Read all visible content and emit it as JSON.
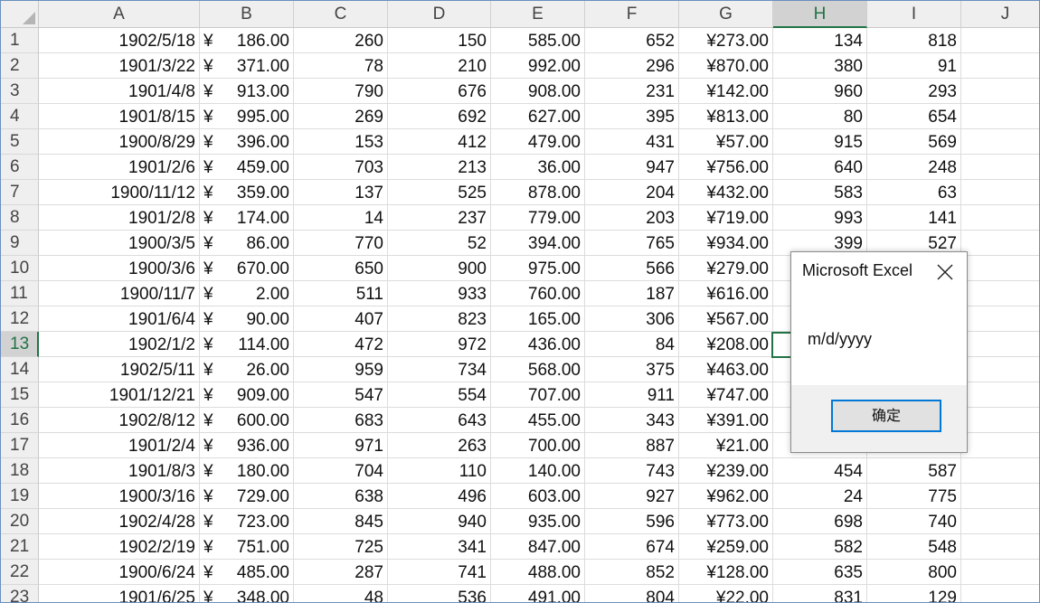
{
  "columns": [
    "A",
    "B",
    "C",
    "D",
    "E",
    "F",
    "G",
    "H",
    "I",
    "J"
  ],
  "selected_column": "H",
  "selected_row": "13",
  "rows": [
    {
      "n": "1",
      "A": "1902/5/18",
      "B": "186.00",
      "C": "260",
      "D": "150",
      "E": "585.00",
      "F": "652",
      "G": "¥273.00",
      "H": "134",
      "I": "818"
    },
    {
      "n": "2",
      "A": "1901/3/22",
      "B": "371.00",
      "C": "78",
      "D": "210",
      "E": "992.00",
      "F": "296",
      "G": "¥870.00",
      "H": "380",
      "I": "91"
    },
    {
      "n": "3",
      "A": "1901/4/8",
      "B": "913.00",
      "C": "790",
      "D": "676",
      "E": "908.00",
      "F": "231",
      "G": "¥142.00",
      "H": "960",
      "I": "293"
    },
    {
      "n": "4",
      "A": "1901/8/15",
      "B": "995.00",
      "C": "269",
      "D": "692",
      "E": "627.00",
      "F": "395",
      "G": "¥813.00",
      "H": "80",
      "I": "654"
    },
    {
      "n": "5",
      "A": "1900/8/29",
      "B": "396.00",
      "C": "153",
      "D": "412",
      "E": "479.00",
      "F": "431",
      "G": "¥57.00",
      "H": "915",
      "I": "569"
    },
    {
      "n": "6",
      "A": "1901/2/6",
      "B": "459.00",
      "C": "703",
      "D": "213",
      "E": "36.00",
      "F": "947",
      "G": "¥756.00",
      "H": "640",
      "I": "248"
    },
    {
      "n": "7",
      "A": "1900/11/12",
      "B": "359.00",
      "C": "137",
      "D": "525",
      "E": "878.00",
      "F": "204",
      "G": "¥432.00",
      "H": "583",
      "I": "63"
    },
    {
      "n": "8",
      "A": "1901/2/8",
      "B": "174.00",
      "C": "14",
      "D": "237",
      "E": "779.00",
      "F": "203",
      "G": "¥719.00",
      "H": "993",
      "I": "141"
    },
    {
      "n": "9",
      "A": "1900/3/5",
      "B": "86.00",
      "C": "770",
      "D": "52",
      "E": "394.00",
      "F": "765",
      "G": "¥934.00",
      "H": "399",
      "I": "527"
    },
    {
      "n": "10",
      "A": "1900/3/6",
      "B": "670.00",
      "C": "650",
      "D": "900",
      "E": "975.00",
      "F": "566",
      "G": "¥279.00",
      "H": "",
      "I": ""
    },
    {
      "n": "11",
      "A": "1900/11/7",
      "B": "2.00",
      "C": "511",
      "D": "933",
      "E": "760.00",
      "F": "187",
      "G": "¥616.00",
      "H": "",
      "I": ""
    },
    {
      "n": "12",
      "A": "1901/6/4",
      "B": "90.00",
      "C": "407",
      "D": "823",
      "E": "165.00",
      "F": "306",
      "G": "¥567.00",
      "H": "",
      "I": ""
    },
    {
      "n": "13",
      "A": "1902/1/2",
      "B": "114.00",
      "C": "472",
      "D": "972",
      "E": "436.00",
      "F": "84",
      "G": "¥208.00",
      "H": "",
      "I": ""
    },
    {
      "n": "14",
      "A": "1902/5/11",
      "B": "26.00",
      "C": "959",
      "D": "734",
      "E": "568.00",
      "F": "375",
      "G": "¥463.00",
      "H": "",
      "I": ""
    },
    {
      "n": "15",
      "A": "1901/12/21",
      "B": "909.00",
      "C": "547",
      "D": "554",
      "E": "707.00",
      "F": "911",
      "G": "¥747.00",
      "H": "",
      "I": ""
    },
    {
      "n": "16",
      "A": "1902/8/12",
      "B": "600.00",
      "C": "683",
      "D": "643",
      "E": "455.00",
      "F": "343",
      "G": "¥391.00",
      "H": "",
      "I": ""
    },
    {
      "n": "17",
      "A": "1901/2/4",
      "B": "936.00",
      "C": "971",
      "D": "263",
      "E": "700.00",
      "F": "887",
      "G": "¥21.00",
      "H": "",
      "I": ""
    },
    {
      "n": "18",
      "A": "1901/8/3",
      "B": "180.00",
      "C": "704",
      "D": "110",
      "E": "140.00",
      "F": "743",
      "G": "¥239.00",
      "H": "454",
      "I": "587"
    },
    {
      "n": "19",
      "A": "1900/3/16",
      "B": "729.00",
      "C": "638",
      "D": "496",
      "E": "603.00",
      "F": "927",
      "G": "¥962.00",
      "H": "24",
      "I": "775"
    },
    {
      "n": "20",
      "A": "1902/4/28",
      "B": "723.00",
      "C": "845",
      "D": "940",
      "E": "935.00",
      "F": "596",
      "G": "¥773.00",
      "H": "698",
      "I": "740"
    },
    {
      "n": "21",
      "A": "1902/2/19",
      "B": "751.00",
      "C": "725",
      "D": "341",
      "E": "847.00",
      "F": "674",
      "G": "¥259.00",
      "H": "582",
      "I": "548"
    },
    {
      "n": "22",
      "A": "1900/6/24",
      "B": "485.00",
      "C": "287",
      "D": "741",
      "E": "488.00",
      "F": "852",
      "G": "¥128.00",
      "H": "635",
      "I": "800"
    },
    {
      "n": "23",
      "A": "1901/6/25",
      "B": "348.00",
      "C": "48",
      "D": "536",
      "E": "491.00",
      "F": "804",
      "G": "¥22.00",
      "H": "831",
      "I": "129"
    }
  ],
  "currency_symbol": "¥",
  "dialog": {
    "title": "Microsoft Excel",
    "message": "m/d/yyyy",
    "ok_label": "确定",
    "close_icon": "close-icon"
  },
  "colors": {
    "accent": "#217346",
    "button_border": "#0078d7"
  }
}
